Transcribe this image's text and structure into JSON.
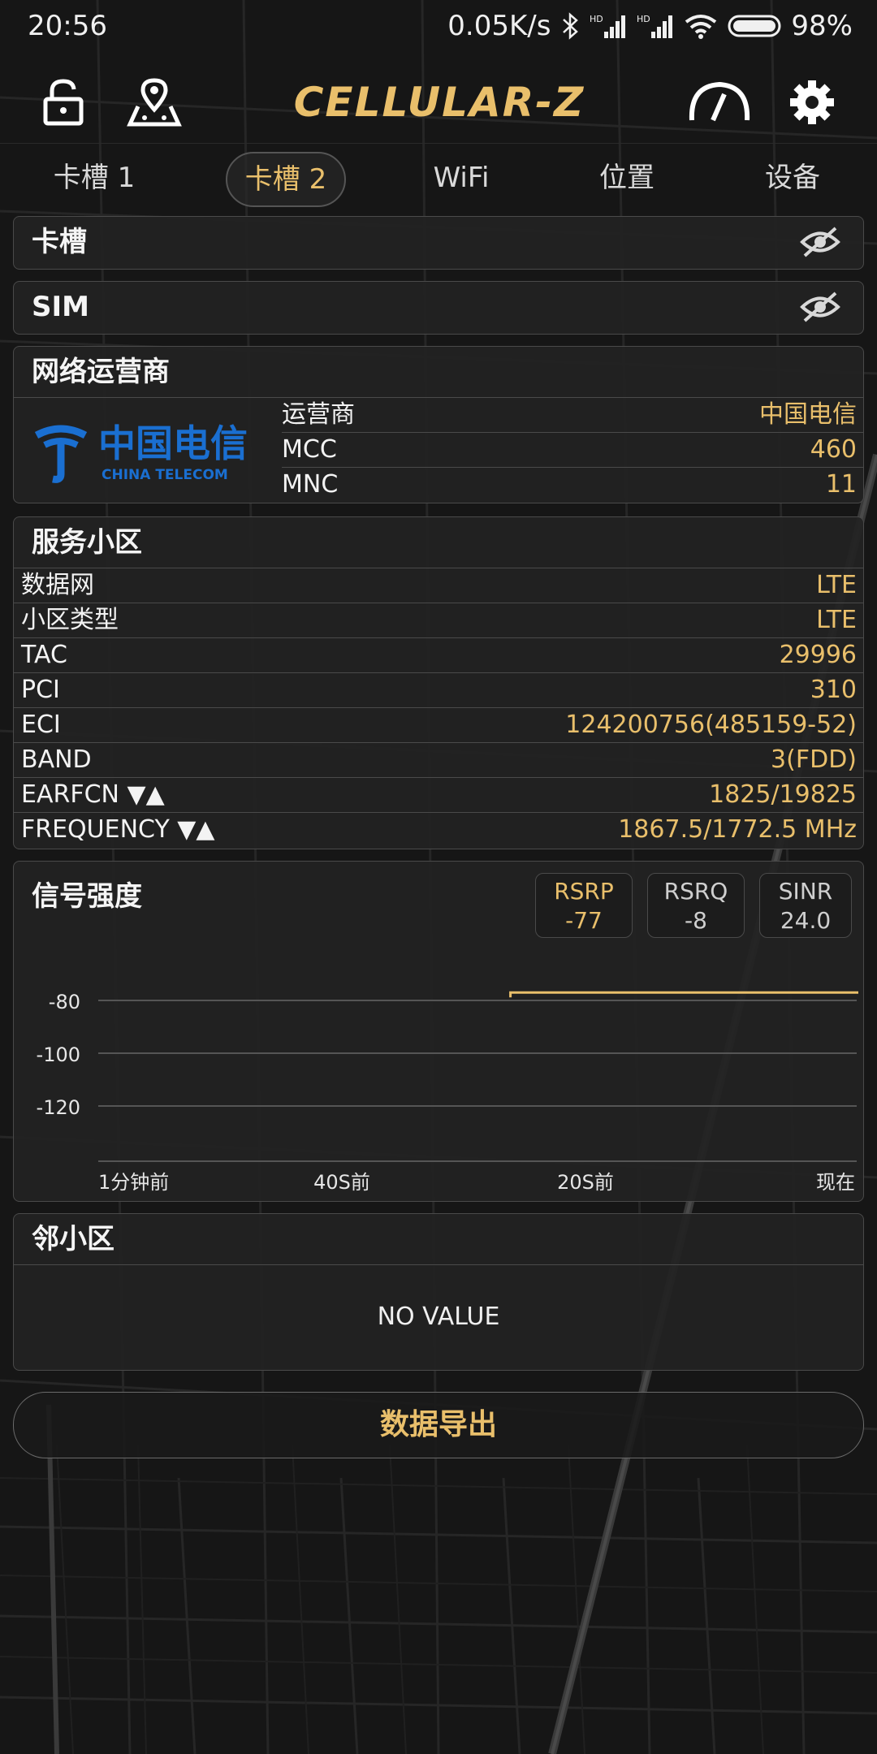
{
  "status_bar": {
    "time": "20:56",
    "net_speed": "0.05K/s",
    "battery": "98%"
  },
  "header": {
    "app_name": "CELLULAR-Z",
    "icons": [
      "unlock-icon",
      "map-pin-icon",
      "speedometer-icon",
      "gear-icon"
    ]
  },
  "tabs": [
    "卡槽 1",
    "卡槽 2",
    "WiFi",
    "位置",
    "设备"
  ],
  "active_tab": "卡槽 2",
  "sections": {
    "slot": "卡槽",
    "sim": "SIM",
    "operator": {
      "title": "网络运营商",
      "logo_text_cn": "中国电信",
      "logo_text_en": "CHINA TELECOM",
      "rows": [
        {
          "label": "运营商",
          "value": "中国电信"
        },
        {
          "label": "MCC",
          "value": "460"
        },
        {
          "label": "MNC",
          "value": "11"
        }
      ]
    },
    "serving_cell": {
      "title": "服务小区",
      "rows": [
        {
          "label": "数据网",
          "value": "LTE"
        },
        {
          "label": "小区类型",
          "value": "LTE"
        },
        {
          "label": "TAC",
          "value": "29996"
        },
        {
          "label": "PCI",
          "value": "310"
        },
        {
          "label": "ECI",
          "value": "124200756(485159-52)"
        },
        {
          "label": "BAND",
          "value": "3(FDD)"
        },
        {
          "label": "EARFCN ▼▲",
          "value": "1825/19825"
        },
        {
          "label": "FREQUENCY ▼▲",
          "value": "1867.5/1772.5 MHz"
        }
      ]
    },
    "signal": {
      "title": "信号强度",
      "metrics": [
        {
          "name": "RSRP",
          "value": "-77"
        },
        {
          "name": "RSRQ",
          "value": "-8"
        },
        {
          "name": "SINR",
          "value": "24.0"
        }
      ]
    },
    "neighbor": {
      "title": "邻小区",
      "empty_text": "NO VALUE"
    }
  },
  "export_label": "数据导出",
  "colors": {
    "accent": "#e9bf6b",
    "background": "#151515",
    "card": "#222222",
    "border": "#4a4a4a"
  },
  "chart_data": {
    "type": "line",
    "title": "",
    "xlabel": "",
    "ylabel": "",
    "x_tick_labels": [
      "1分钟前",
      "40S前",
      "20S前",
      "现在"
    ],
    "y_ticks": [
      -80,
      -100,
      -120
    ],
    "ylim": [
      -140,
      -70
    ],
    "grid": true,
    "series": [
      {
        "color": "#e9bf6b",
        "x": [
          -27,
          0
        ],
        "values": [
          -77,
          -77
        ]
      }
    ]
  }
}
